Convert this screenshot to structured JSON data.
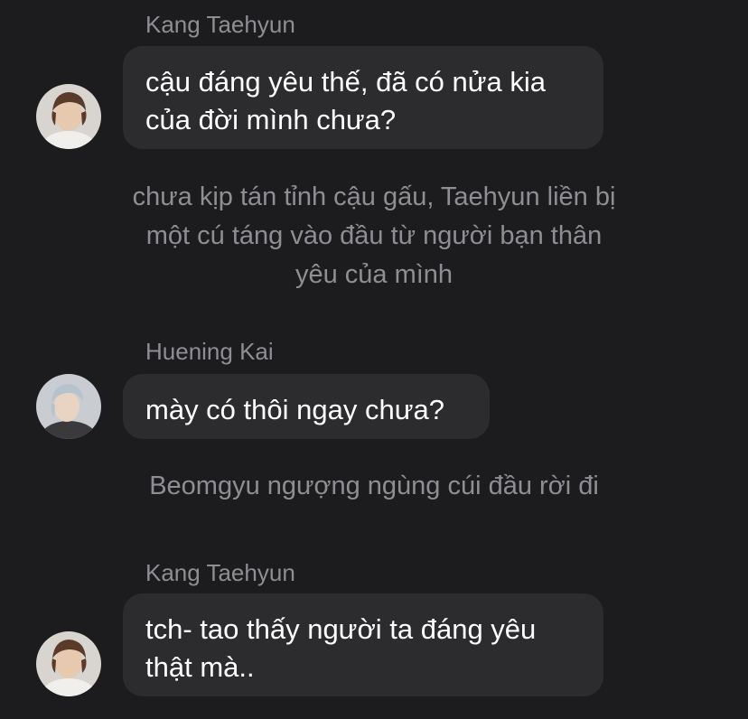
{
  "colors": {
    "background": "#1c1c1e",
    "bubble": "#2c2c2e",
    "muted_text": "#8e8e93",
    "message_text": "#ffffff"
  },
  "messages": [
    {
      "sender": "Kang Taehyun",
      "lines": [
        "cậu đáng yêu thế, đã có nửa kia",
        "của đời mình chưa?"
      ],
      "avatar": "taehyun-avatar"
    },
    {
      "sender": "Huening Kai",
      "lines": [
        "mày có thôi ngay chưa?"
      ],
      "avatar": "hueningkai-avatar"
    },
    {
      "sender": "Kang Taehyun",
      "lines": [
        "tch- tao thấy người ta đáng yêu",
        "thật mà.."
      ],
      "avatar": "taehyun-avatar"
    }
  ],
  "narrations": [
    {
      "lines": [
        "chưa kịp tán tỉnh cậu gấu, Taehyun liền bị",
        "một cú táng vào đầu từ người bạn thân",
        "yêu của mình"
      ]
    },
    {
      "lines": [
        "Beomgyu ngượng ngùng cúi đầu rời đi"
      ]
    }
  ]
}
